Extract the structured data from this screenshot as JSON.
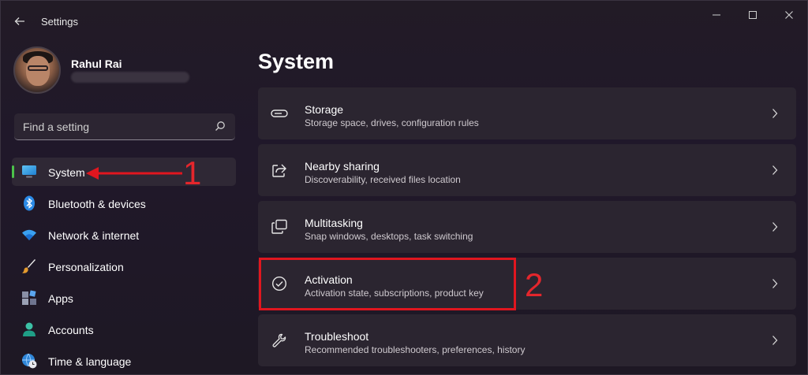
{
  "window": {
    "title": "Settings",
    "controls": {
      "minimize": "—",
      "maximize": "☐",
      "close": "✕"
    }
  },
  "profile": {
    "name": "Rahul Rai"
  },
  "search": {
    "placeholder": "Find a setting"
  },
  "sidebar": {
    "items": [
      {
        "label": "System",
        "icon": "monitor-icon",
        "selected": true
      },
      {
        "label": "Bluetooth & devices",
        "icon": "bluetooth-icon"
      },
      {
        "label": "Network & internet",
        "icon": "wifi-icon"
      },
      {
        "label": "Personalization",
        "icon": "brush-icon"
      },
      {
        "label": "Apps",
        "icon": "apps-icon"
      },
      {
        "label": "Accounts",
        "icon": "accounts-icon"
      },
      {
        "label": "Time & language",
        "icon": "globe-clock-icon"
      }
    ]
  },
  "main": {
    "title": "System",
    "cards": [
      {
        "title": "Storage",
        "subtitle": "Storage space, drives, configuration rules",
        "icon": "storage-icon"
      },
      {
        "title": "Nearby sharing",
        "subtitle": "Discoverability, received files location",
        "icon": "share-icon"
      },
      {
        "title": "Multitasking",
        "subtitle": "Snap windows, desktops, task switching",
        "icon": "multitasking-icon"
      },
      {
        "title": "Activation",
        "subtitle": "Activation state, subscriptions, product key",
        "icon": "check-circle-icon"
      },
      {
        "title": "Troubleshoot",
        "subtitle": "Recommended troubleshooters, preferences, history",
        "icon": "wrench-icon"
      }
    ]
  },
  "annotations": {
    "step1": "1",
    "step2": "2",
    "color": "#e0161f"
  },
  "colors": {
    "accent": "#4cc24a",
    "background": "#201a26",
    "card": "#2b2530"
  }
}
